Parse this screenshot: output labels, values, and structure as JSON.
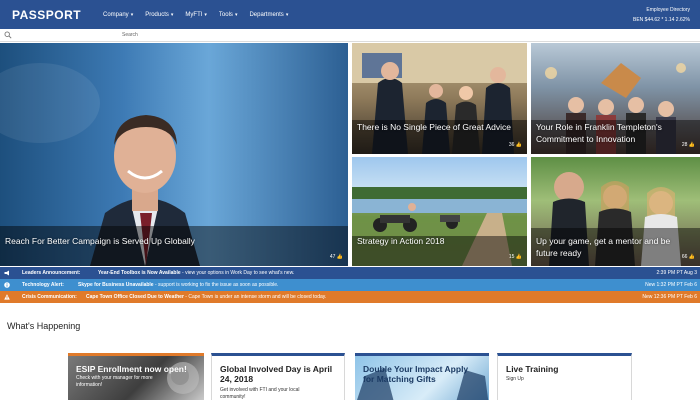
{
  "header": {
    "brand": "PASSPORT",
    "nav": [
      "Company",
      "Products",
      "MyFTI",
      "Tools",
      "Departments"
    ],
    "directory_link": "Employee Directory",
    "ticker": "BEN $44.62 * 1.14 2.62%"
  },
  "search": {
    "placeholder": "Search"
  },
  "tiles": {
    "hero": {
      "title": "Reach For Better Campaign is Served Up Globally",
      "likes": "47"
    },
    "t1": {
      "title": "There is No Single Piece of Great Advice",
      "likes": "36"
    },
    "t2": {
      "title": "Your Role in Franklin Templeton's Commitment to Innovation",
      "likes": "28"
    },
    "t3": {
      "title": "Strategy in Action 2018",
      "likes": "15"
    },
    "t4": {
      "title": "Up your game, get a mentor and be future ready",
      "likes": "66"
    }
  },
  "alerts": [
    {
      "label": "Leaders Announcement:",
      "link": "Year-End Toolbox is Now Available",
      "text": " - view your options in Work Day to see what's new.",
      "time": "2:39 PM PT Aug 3",
      "color": "#2b5192"
    },
    {
      "label": "Technology Alert:",
      "link": "Skype for Business Unavailable",
      "text": " - support is working to fix the issue as soon as possible.",
      "time": "New 1:32 PM PT Feb 6",
      "color": "#3e8fcf"
    },
    {
      "label": "Crisis Communication:",
      "link": "Cape Town Office Closed Due to Weather",
      "text": " - Cape Town is under an intense storm and will be closed today.",
      "time": "New 12:36 PM PT Feb 6",
      "color": "#e07a2a"
    }
  ],
  "section": {
    "title": "What's Happening"
  },
  "cards": [
    {
      "title": "ESIP Enrollment now open!",
      "sub": "Check with your manager for more information!"
    },
    {
      "title": "Global Involved Day is April 24, 2018",
      "sub": "Get involved with FTI and your local community!"
    },
    {
      "title": "Double Your Impact Apply for Matching Gifts",
      "sub": ""
    },
    {
      "title": "Live Training",
      "sub": "Sign Up"
    }
  ]
}
